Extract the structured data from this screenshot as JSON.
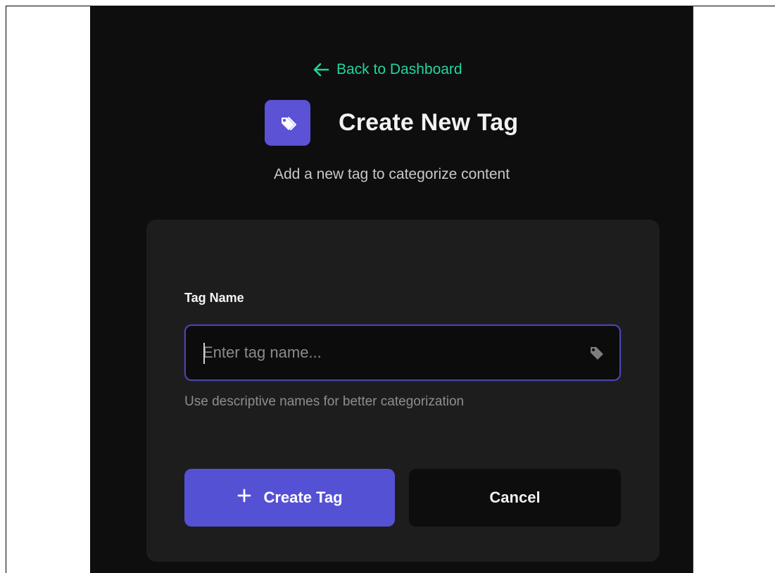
{
  "nav": {
    "back_label": "Back to Dashboard"
  },
  "header": {
    "title": "Create New Tag",
    "subtitle": "Add a new tag to categorize content",
    "icon": "tags-icon"
  },
  "form": {
    "tag_name_label": "Tag Name",
    "tag_name_value": "",
    "tag_name_placeholder": "Enter tag name...",
    "helper_text": "Use descriptive names for better categorization",
    "input_icon": "tag-icon"
  },
  "actions": {
    "create_label": "Create Tag",
    "cancel_label": "Cancel"
  },
  "colors": {
    "accent_green": "#1fd6a0",
    "primary_purple": "#5551d4",
    "page_background": "#0e0e0e",
    "card_background": "#1d1d1d"
  }
}
